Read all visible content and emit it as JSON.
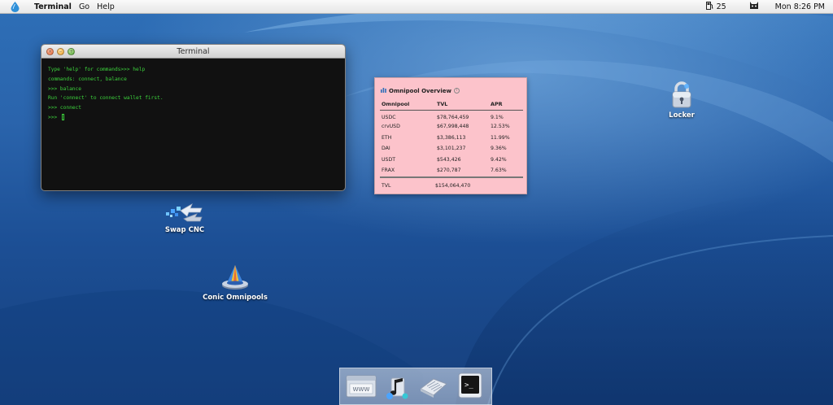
{
  "menubar": {
    "logo_icon": "water-drop-icon",
    "app_name": "Terminal",
    "menus": [
      "Go",
      "Help"
    ],
    "gas_value": "25",
    "time": "Mon 8:26 PM"
  },
  "terminal": {
    "title": "Terminal",
    "lines": [
      "Type 'help' for commands>>> help",
      "commands: connect, balance",
      ">>> balance",
      "Run 'connect' to connect wallet first.",
      ">>> connect",
      ">>> "
    ]
  },
  "desktop_icons": {
    "locker": "Locker",
    "swap": "Swap CNC",
    "omnipools": "Conic Omnipools"
  },
  "widget": {
    "title": "Omnipool Overview",
    "headers": [
      "Omnipool",
      "TVL",
      "APR"
    ],
    "rows": [
      [
        "USDC",
        "$78,764,459",
        "9.1%"
      ],
      [
        "crvUSD",
        "$67,998,448",
        "12.53%"
      ],
      [
        "ETH",
        "$3,386,113",
        "11.99%"
      ],
      [
        "DAI",
        "$3,101,237",
        "9.36%"
      ],
      [
        "USDT",
        "$543,426",
        "9.42%"
      ],
      [
        "FRAX",
        "$270,787",
        "7.63%"
      ]
    ],
    "total_label": "TVL",
    "total_value": "$154,064,470"
  },
  "dock": {
    "items": [
      "browser-window-icon",
      "music-note-icon",
      "document-icon",
      "terminal-icon"
    ],
    "browser_label": "WWW"
  },
  "colors": {
    "terminal_text": "#3cd23c",
    "widget_bg": "#fcc3cb"
  }
}
